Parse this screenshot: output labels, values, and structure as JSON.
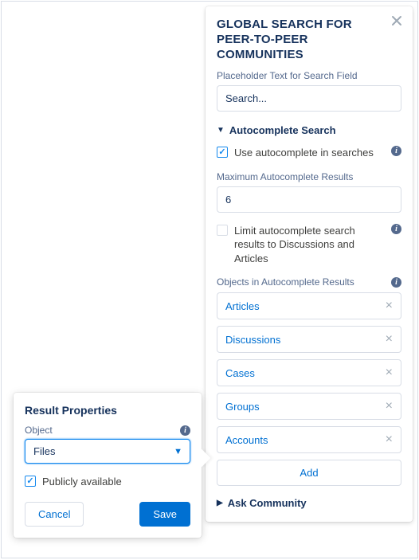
{
  "panel": {
    "title": "GLOBAL SEARCH FOR PEER-TO-PEER COMMUNITIES",
    "placeholder_label": "Placeholder Text for Search Field",
    "placeholder_value": "Search...",
    "autocomplete_section": "Autocomplete Search",
    "use_autocomplete_label": "Use autocomplete in searches",
    "max_results_label": "Maximum Autocomplete Results",
    "max_results_value": "6",
    "limit_label": "Limit autocomplete search results to Discussions and Articles",
    "objects_label": "Objects in Autocomplete Results",
    "objects": [
      {
        "label": "Articles"
      },
      {
        "label": "Discussions"
      },
      {
        "label": "Cases"
      },
      {
        "label": "Groups"
      },
      {
        "label": "Accounts"
      }
    ],
    "add_label": "Add",
    "ask_section": "Ask Community"
  },
  "popover": {
    "title": "Result Properties",
    "object_label": "Object",
    "object_value": "Files",
    "publicly_available_label": "Publicly available",
    "cancel": "Cancel",
    "save": "Save"
  }
}
